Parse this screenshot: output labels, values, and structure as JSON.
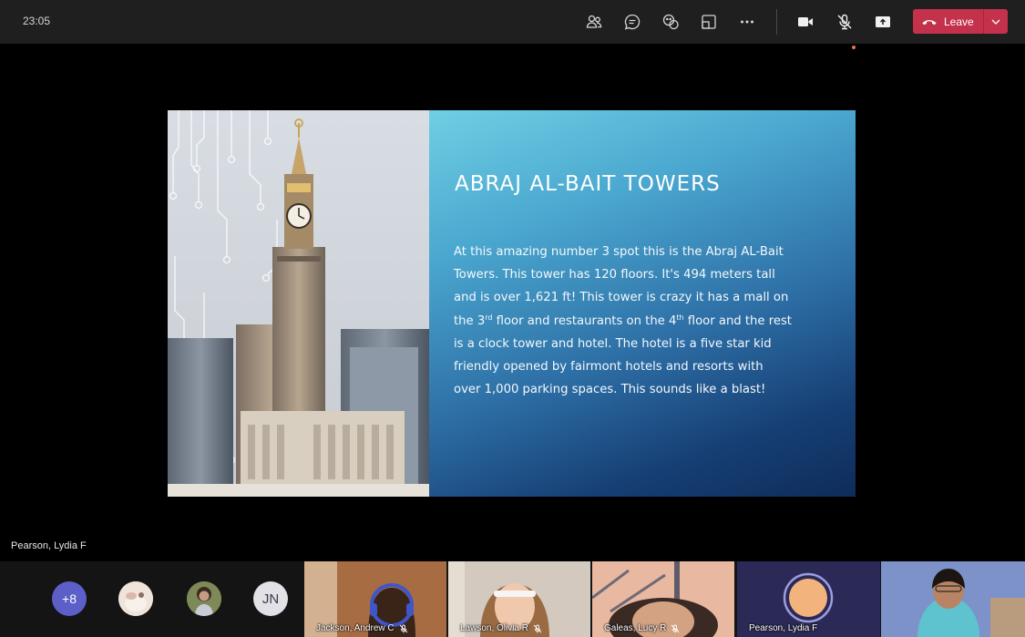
{
  "meeting": {
    "time": "23:05",
    "leave_label": "Leave"
  },
  "toolbar": {
    "icons": [
      "people-icon",
      "chat-icon",
      "reactions-icon",
      "rooms-icon",
      "more-options-icon",
      "camera-icon",
      "mic-off-icon",
      "share-screen-icon",
      "hangup-icon",
      "chevron-down-icon"
    ]
  },
  "slide": {
    "title": "ABRAJ AL-BAIT TOWERS",
    "body_part1": "At this amazing number 3 spot this is the Abraj AL-Bait Towers. This tower has 120 floors. It's 494 meters tall and is over 1,621 ft! This tower is crazy it has a mall on the 3",
    "sup1": "rd",
    "body_part2": " floor and restaurants on the 4",
    "sup2": "th",
    "body_part3": " floor and the rest is a clock tower and hotel. The hotel is a five star kid friendly opened by fairmont hotels and resorts with over 1,000 parking spaces. This sounds like a blast!"
  },
  "presenter": {
    "name": "Pearson, Lydia F"
  },
  "gallery": {
    "overflow_count": "+8",
    "initials": "JN",
    "participants": [
      {
        "name": "Jackson, Andrew C",
        "muted": true
      },
      {
        "name": "Lawson, Olivia R",
        "muted": true
      },
      {
        "name": "Galeas, Lucy R",
        "muted": true
      },
      {
        "name": "Pearson, Lydia F",
        "muted": false
      },
      {
        "name": "",
        "muted": false
      }
    ]
  },
  "colors": {
    "leave": "#c4314b",
    "topbar": "#1f1f1f",
    "accent": "#5b5fc7"
  }
}
